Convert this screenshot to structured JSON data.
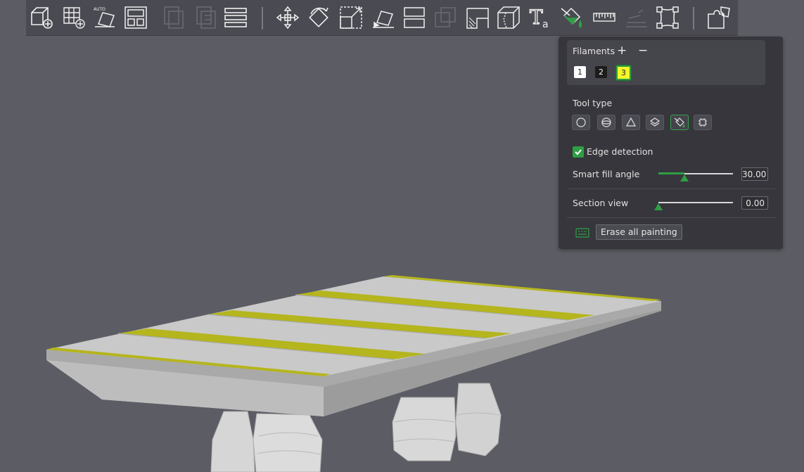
{
  "toolbar": {
    "tools": [
      {
        "name": "add-object-icon",
        "enabled": true
      },
      {
        "name": "add-plate-icon",
        "enabled": true
      },
      {
        "name": "auto-orient-icon",
        "enabled": true
      },
      {
        "name": "arrange-icon",
        "enabled": true
      },
      {
        "name": "copy-icon",
        "enabled": false
      },
      {
        "name": "paste-icon",
        "enabled": false
      },
      {
        "name": "layers-icon",
        "enabled": true
      },
      {
        "name": "move-icon",
        "enabled": true
      },
      {
        "name": "rotate-icon",
        "enabled": true
      },
      {
        "name": "scale-icon",
        "enabled": true
      },
      {
        "name": "lay-on-face-icon",
        "enabled": true
      },
      {
        "name": "cut-icon",
        "enabled": true
      },
      {
        "name": "boolean-icon",
        "enabled": false
      },
      {
        "name": "support-painting-icon",
        "enabled": true
      },
      {
        "name": "seam-painting-icon",
        "enabled": true
      },
      {
        "name": "text-icon",
        "enabled": true
      },
      {
        "name": "color-painting-icon",
        "enabled": true
      },
      {
        "name": "measure-icon",
        "enabled": true
      },
      {
        "name": "assembly-icon",
        "enabled": false
      },
      {
        "name": "mesh-boolean-icon",
        "enabled": true
      },
      {
        "name": "split-to-objects-icon",
        "enabled": true
      }
    ]
  },
  "panel": {
    "filaments_title": "Filaments",
    "add_symbol": "+",
    "remove_symbol": "−",
    "filaments": [
      {
        "label": "1",
        "color": "#ffffff"
      },
      {
        "label": "2",
        "color": "#1c1c1c"
      },
      {
        "label": "3",
        "color": "#f5f52a",
        "selected": true
      }
    ],
    "tool_type_label": "Tool type",
    "tool_types": [
      "circle-tool-icon",
      "sphere-tool-icon",
      "triangle-tool-icon",
      "height-range-tool-icon",
      "fill-tool-icon",
      "gap-fill-tool-icon"
    ],
    "selected_tool": "fill-tool-icon",
    "edge_detection_label": "Edge detection",
    "edge_detection_checked": true,
    "smart_fill_label": "Smart fill angle",
    "smart_fill_value": "30.00",
    "smart_fill_fraction": 0.35,
    "section_view_label": "Section view",
    "section_view_value": "0.00",
    "section_view_fraction": 0.0,
    "erase_label": "Erase all painting"
  },
  "colors": {
    "background": "#5c5c64",
    "accent": "#2f9e44",
    "paint": "#b5b51e",
    "model": "#c8c8c8"
  }
}
